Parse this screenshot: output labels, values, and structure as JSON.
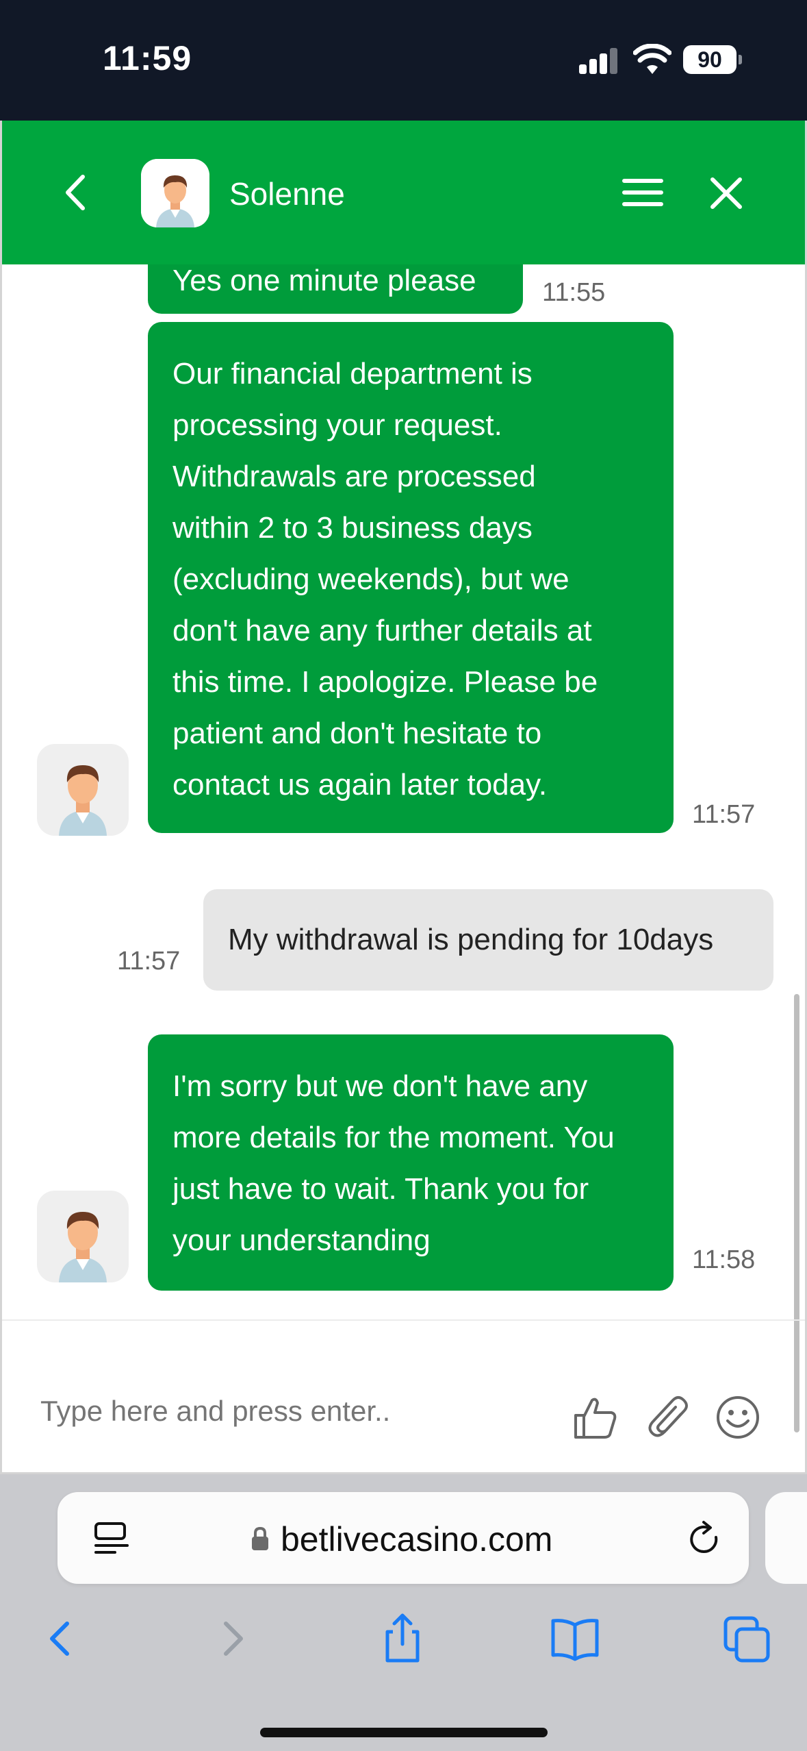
{
  "status_bar": {
    "time": "11:59",
    "battery": "90"
  },
  "chat_header": {
    "agent_name": "Solenne"
  },
  "messages": [
    {
      "from": "agent",
      "text": "Yes one minute please",
      "time": "11:55"
    },
    {
      "from": "agent",
      "lines": [
        "Our financial department is",
        "processing your request.",
        "Withdrawals are processed",
        "within 2 to 3 business days",
        "(excluding weekends), but we",
        "don't have any further details at",
        "this time. I apologize. Please be",
        "patient and don't hesitate to",
        "contact us again later today."
      ],
      "time": "11:57"
    },
    {
      "from": "user",
      "text": "My withdrawal is pending for 10days",
      "time": "11:57"
    },
    {
      "from": "agent",
      "lines": [
        "I'm sorry but we don't have any",
        "more details for the moment. You",
        "just have to wait. Thank you for",
        "your understanding"
      ],
      "time": "11:58"
    }
  ],
  "composer": {
    "placeholder": "Type here and press enter.."
  },
  "browser": {
    "url": "betlivecasino.com"
  },
  "colors": {
    "brand_green": "#00a63e",
    "bubble_green": "#009c3b",
    "safari_blue": "#1a7cf5"
  },
  "icons": [
    "back-icon",
    "menu-icon",
    "close-icon",
    "thumbs-up-icon",
    "paperclip-icon",
    "smiley-icon",
    "reader-icon",
    "lock-icon",
    "reload-icon",
    "share-icon",
    "bookmarks-icon",
    "tabs-icon"
  ]
}
